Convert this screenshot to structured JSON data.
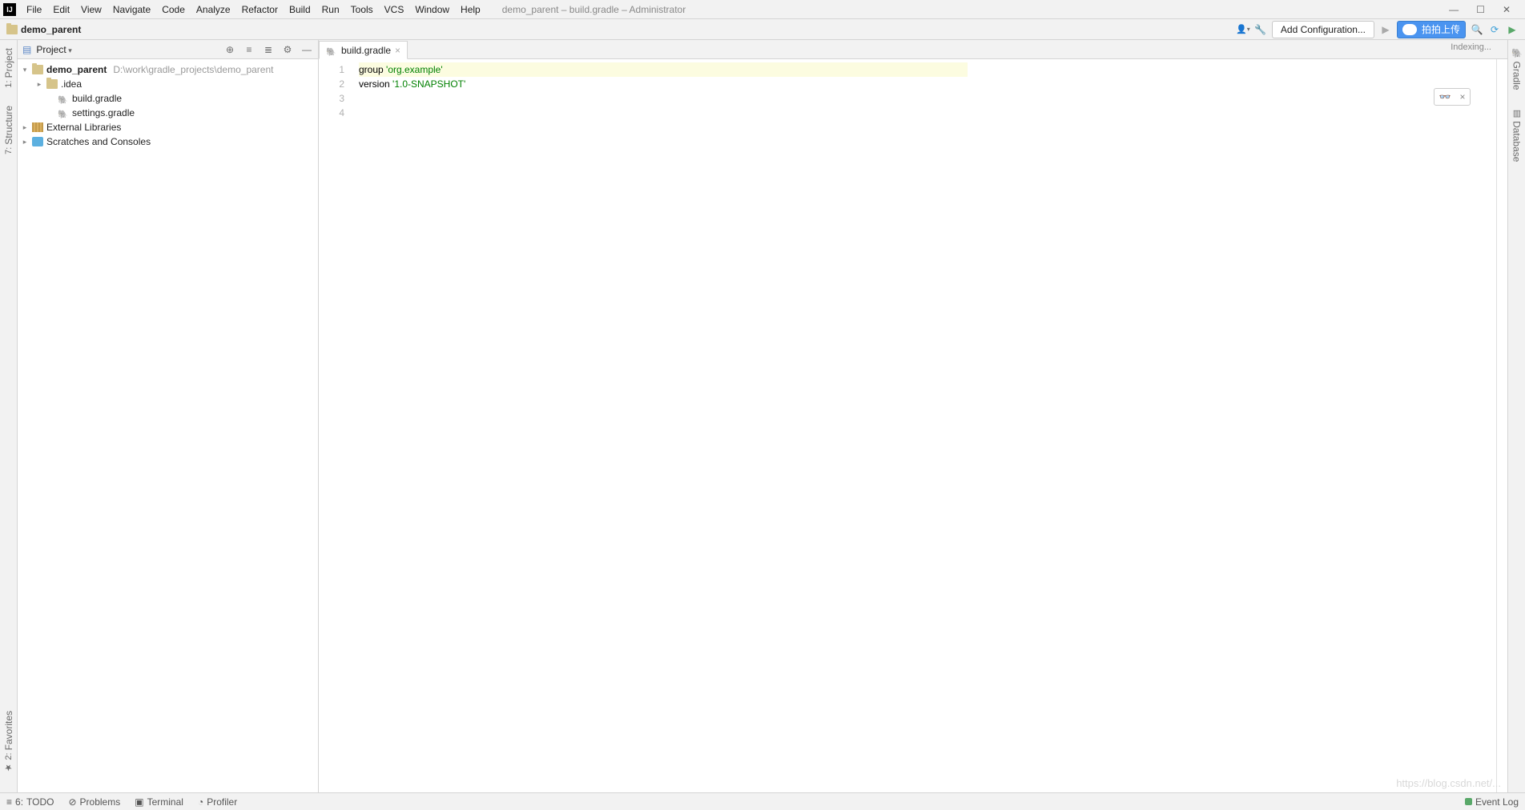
{
  "window": {
    "title": "demo_parent – build.gradle – Administrator",
    "minimize": "—",
    "maximize": "☐",
    "close": "✕"
  },
  "menubar": [
    "File",
    "Edit",
    "View",
    "Navigate",
    "Code",
    "Analyze",
    "Refactor",
    "Build",
    "Run",
    "Tools",
    "VCS",
    "Window",
    "Help"
  ],
  "breadcrumb": {
    "project": "demo_parent"
  },
  "toolbar": {
    "add_config": "Add Configuration...",
    "upload_btn": "拍拍上传"
  },
  "project_panel": {
    "title": "Project",
    "tree": {
      "root": {
        "name": "demo_parent",
        "path": "D:\\work\\gradle_projects\\demo_parent"
      },
      "idea": ".idea",
      "build_gradle": "build.gradle",
      "settings_gradle": "settings.gradle",
      "ext_lib": "External Libraries",
      "scratches": "Scratches and Consoles"
    }
  },
  "left_tabs": {
    "project": "Project",
    "structure": "Structure",
    "favorites": "Favorites"
  },
  "right_tabs": {
    "gradle": "Gradle",
    "database": "Database"
  },
  "editor": {
    "tab_name": "build.gradle",
    "indexing": "Indexing...",
    "lines": {
      "l1": "1",
      "l2": "2",
      "l3": "3",
      "l4": "4"
    },
    "code": {
      "l1a": "group ",
      "l1b": "'org.example'",
      "l2a": "version ",
      "l2b": "'1.0-SNAPSHOT'"
    }
  },
  "statusbar": {
    "todo": "TODO",
    "problems": "Problems",
    "terminal": "Terminal",
    "profiler": "Profiler",
    "event_log": "Event Log"
  },
  "watermark": "https://blog.csdn.net/..."
}
